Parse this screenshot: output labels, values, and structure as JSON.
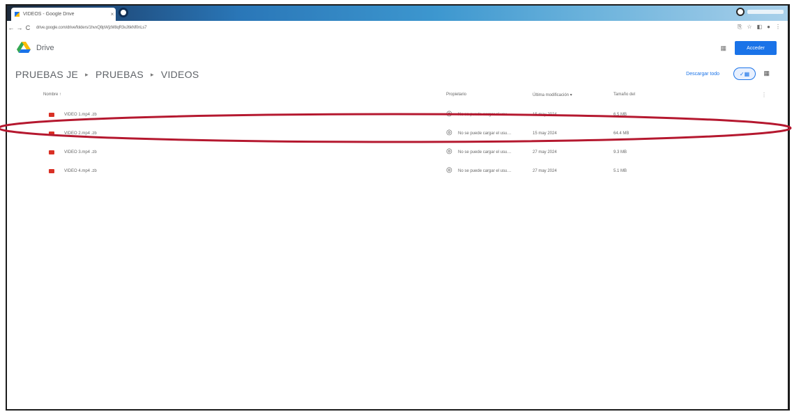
{
  "browser": {
    "tab_title": "VIDEOS - Google Drive",
    "tab_close": "×",
    "url": "drive.google.com/drive/folders/1hvxQ8pWjzM8qR3vJ6kNf0nLs7",
    "back": "←",
    "forward": "→",
    "reload": "C"
  },
  "drive": {
    "brand": "Drive",
    "access_button": "Acceder",
    "brand_colors": [
      "#1a73e8",
      "#fbbc04",
      "#34a853"
    ]
  },
  "breadcrumb": {
    "items": [
      "PRUEBAS JE",
      "PRUEBAS",
      "VIDEOS"
    ],
    "separator": "▸"
  },
  "toolbar": {
    "manage_link": "Descargar todo",
    "grid_toggle": "✓▦",
    "list_icon": "▦"
  },
  "table": {
    "headers": {
      "name": "Nombre ↑",
      "owner": "Propietario",
      "modified": "Última modificación ▾",
      "size": "Tamaño del"
    },
    "rows": [
      {
        "name": "VIDEO 1.mp4 .zb",
        "owner": "No se puede cargar el usu…",
        "date": "15 may 2024",
        "size": "6.5 MB"
      },
      {
        "name": "VIDEO 2.mp4 .zb",
        "owner": "No se puede cargar el usu…",
        "date": "15 may 2024",
        "size": "64.4 MB"
      },
      {
        "name": "VIDEO 3.mp4 .zb",
        "owner": "No se puede cargar el usu…",
        "date": "27 may 2024",
        "size": "9.3 MB"
      },
      {
        "name": "VIDEO 4.mp4 .zb",
        "owner": "No se puede cargar el usu…",
        "date": "27 may 2024",
        "size": "5.1 MB"
      }
    ]
  },
  "annotation_color": "#b5182f"
}
